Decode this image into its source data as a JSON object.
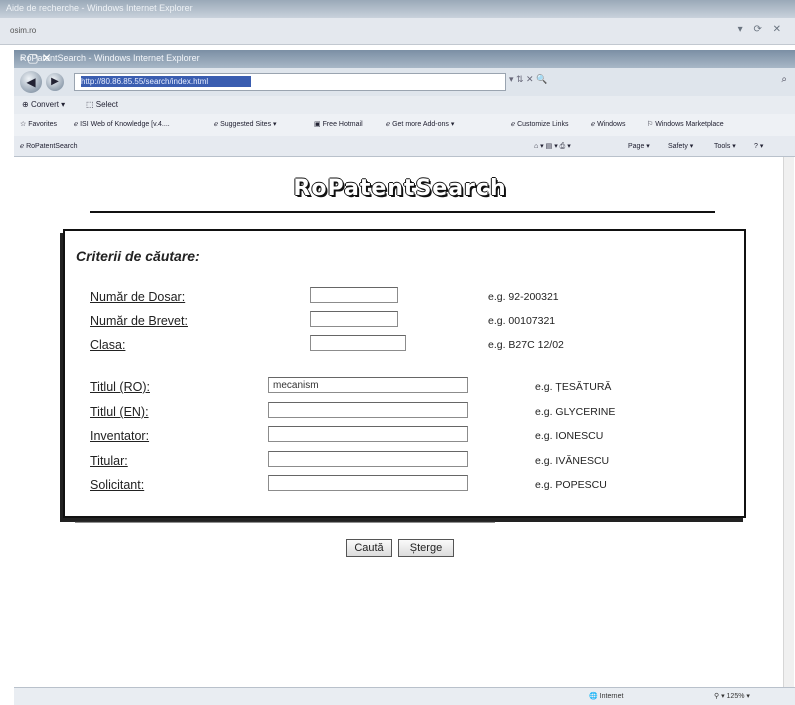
{
  "browser": {
    "outer_title": "Aide de recherche - Windows Internet Explorer",
    "outer_address": "osim.ro",
    "window_title": "RoPatentSearch - Windows Internet Explorer",
    "address": "http://80.86.85.55/search/index.html",
    "command": {
      "convert": "Convert",
      "select": "Select"
    },
    "favorites": {
      "favorites": "Favorites",
      "isi": "ISI Web of Knowledge [v.4....",
      "suggested": "Suggested Sites",
      "hotmail": "Free Hotmail",
      "addons": "Get more Add-ons",
      "customize": "Customize Links",
      "windows": "Windows",
      "marketplace": "Windows Marketplace"
    },
    "tab_title": "RoPatentSearch",
    "menus": {
      "page": "Page",
      "safety": "Safety",
      "tools": "Tools"
    },
    "status": {
      "zone": "Internet",
      "zoom": "125%"
    }
  },
  "page": {
    "logo": "RoPatentSearch",
    "criteria_title": "Criterii de căutare:",
    "fields": [
      {
        "label": "Număr de Dosar:",
        "value": "",
        "example": "e.g. 92-200321"
      },
      {
        "label": "Număr de Brevet:",
        "value": "",
        "example": "e.g. 00107321"
      },
      {
        "label": "Clasa:",
        "value": "",
        "example": "e.g. B27C 12/02"
      },
      {
        "label": "Titlul (RO):",
        "value": "mecanism",
        "example": "e.g. ȚESĂTURĂ"
      },
      {
        "label": "Titlul (EN):",
        "value": "",
        "example": "e.g. GLYCERINE"
      },
      {
        "label": "Inventator:",
        "value": "",
        "example": "e.g. IONESCU"
      },
      {
        "label": "Titular:",
        "value": "",
        "example": "e.g. IVĂNESCU"
      },
      {
        "label": "Solicitant:",
        "value": "",
        "example": "e.g. POPESCU"
      }
    ],
    "search_button": "Caută",
    "clear_button": "Șterge"
  }
}
